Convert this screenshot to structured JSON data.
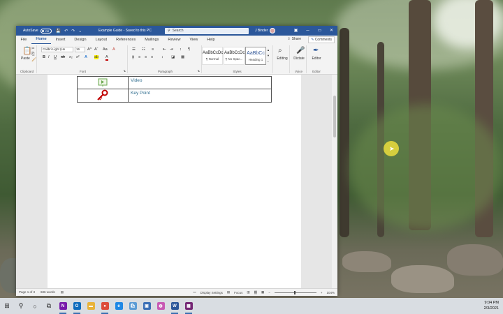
{
  "window": {
    "autosave_label": "AutoSave",
    "autosave_state": "Off",
    "doc_title": "Example Guide - Saved to this PC",
    "search_placeholder": "Search",
    "user_name": "J Binder",
    "qa_save": "💾",
    "qa_undo": "↶",
    "qa_redo": "↷",
    "qa_more": "⌄",
    "minimize": "─",
    "restore": "▭",
    "close": "✕"
  },
  "tabs": [
    "File",
    "Home",
    "Insert",
    "Design",
    "Layout",
    "References",
    "Mailings",
    "Review",
    "View",
    "Help"
  ],
  "share_label": "Share",
  "comments_label": "Comments",
  "ribbon": {
    "clipboard": {
      "paste": "Paste",
      "label": "Clipboard"
    },
    "font": {
      "name": "Calibri Light (He",
      "size": "16",
      "bold": "B",
      "italic": "I",
      "underline": "U",
      "label": "Font",
      "grow": "A^",
      "shrink": "Aˇ",
      "case": "Aa",
      "clear": "A",
      "strike": "ab",
      "sub": "x₂",
      "sup": "x²",
      "effects": "A",
      "highlight": "ab",
      "color": "A"
    },
    "paragraph": {
      "label": "Paragraph",
      "bullets": "☰",
      "numbering": "☷",
      "multilevel": "≡",
      "decrease": "⇤",
      "increase": "⇥",
      "sort": "↕",
      "pilcrow": "¶",
      "align_left": "≡",
      "center": "≡",
      "align_right": "≡",
      "justify": "≡",
      "spacing": "↕",
      "shading": "◪",
      "borders": "▦"
    },
    "styles": {
      "label": "Styles",
      "items": [
        {
          "sample": "AaBbCcDc",
          "name": "¶ Normal"
        },
        {
          "sample": "AaBbCcDc",
          "name": "¶ No Spac..."
        },
        {
          "sample": "AaBbCc",
          "name": "Heading 1"
        }
      ]
    },
    "editing": {
      "label": "Editing"
    },
    "voice": {
      "dictate": "Dictate",
      "label": "Voice"
    },
    "editor": {
      "button": "Editor",
      "label": "Editor"
    }
  },
  "document": {
    "rows": [
      {
        "icon": "video-icon",
        "label": "Video"
      },
      {
        "icon": "key-icon",
        "label": "Key Point"
      }
    ]
  },
  "statusbar": {
    "page": "Page 1 of 3",
    "words": "686 words",
    "display_settings": "Display Settings",
    "focus": "Focus",
    "zoom": "104%",
    "zoom_out": "−",
    "zoom_in": "+"
  },
  "taskbar": {
    "start": "⊞",
    "search": "⚲",
    "cortana": "○",
    "taskview": "⧉",
    "apps": [
      {
        "name": "onenote-icon",
        "color": "#7719aa",
        "glyph": "N",
        "open": true
      },
      {
        "name": "outlook-icon",
        "color": "#0f6cbd",
        "glyph": "O",
        "open": true
      },
      {
        "name": "file-explorer-icon",
        "color": "#e8b33a",
        "glyph": "▬",
        "open": false
      },
      {
        "name": "chrome-icon",
        "color": "#dd4b39",
        "glyph": "●",
        "open": true
      },
      {
        "name": "edge-icon",
        "color": "#1e88e5",
        "glyph": "e",
        "open": false
      },
      {
        "name": "store-icon",
        "color": "#5b9bd5",
        "glyph": "🛍",
        "open": false
      },
      {
        "name": "app-icon",
        "color": "#3b6fb6",
        "glyph": "▣",
        "open": false
      },
      {
        "name": "app-pink-icon",
        "color": "#c85ab4",
        "glyph": "◍",
        "open": false
      },
      {
        "name": "word-icon",
        "color": "#2b579a",
        "glyph": "W",
        "open": true
      },
      {
        "name": "powerapps-icon",
        "color": "#742774",
        "glyph": "▦",
        "open": true
      }
    ],
    "time": "9:04 PM",
    "date": "2/3/2021"
  }
}
